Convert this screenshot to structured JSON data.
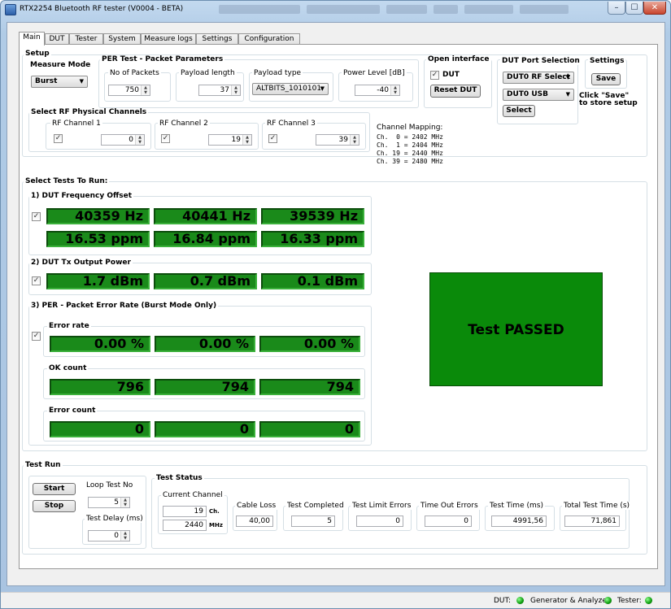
{
  "window": {
    "title": "RTX2254 Bluetooth RF tester (V0004 - BETA)",
    "minimize": "–",
    "maximize": "☐",
    "close": "✕"
  },
  "tabs": [
    "Main",
    "DUT",
    "Tester",
    "System",
    "Measure logs",
    "Settings",
    "Configuration"
  ],
  "setup": {
    "label": "Setup",
    "measure_mode": {
      "label": "Measure Mode",
      "value": "Burst"
    },
    "per": {
      "label": "PER Test - Packet Parameters",
      "no_packets": {
        "label": "No of Packets",
        "value": "750"
      },
      "payload_length": {
        "label": "Payload length",
        "value": "37"
      },
      "payload_type": {
        "label": "Payload type",
        "value": "ALTBITS_1010101"
      },
      "power_level": {
        "label": "Power Level [dB]",
        "value": "-40"
      }
    },
    "open_interface": {
      "label": "Open interface",
      "dut_label": "DUT",
      "reset_label": "Reset DUT"
    },
    "dut_port": {
      "label": "DUT Port Selection",
      "rf_select": "DUT0 RF Select",
      "usb": "DUT0 USB",
      "select_label": "Select"
    },
    "settings": {
      "label": "Settings",
      "save_label": "Save",
      "hint": "Click \"Save\"\nto store setup"
    },
    "rf_channels": {
      "label": "Select RF Physical Channels",
      "items": [
        {
          "label": "RF Channel 1",
          "value": "0"
        },
        {
          "label": "RF Channel 2",
          "value": "19"
        },
        {
          "label": "RF Channel 3",
          "value": "39"
        }
      ]
    },
    "channel_mapping": {
      "label": "Channel Mapping:",
      "lines": [
        "Ch.  0 = 2402 MHz",
        "Ch.  1 = 2404 MHz",
        "Ch. 19 = 2440 MHz",
        "Ch. 39 = 2480 MHz"
      ]
    }
  },
  "tests": {
    "label": "Select Tests To Run:",
    "freq_offset": {
      "label": "1) DUT Frequency Offset",
      "hz": [
        "40359 Hz",
        "40441 Hz",
        "39539 Hz"
      ],
      "ppm": [
        "16.53 ppm",
        "16.84 ppm",
        "16.33 ppm"
      ]
    },
    "tx_power": {
      "label": "2) DUT Tx Output Power",
      "values": [
        "1.7 dBm",
        "0.7 dBm",
        "0.1 dBm"
      ]
    },
    "per": {
      "label": "3) PER - Packet Error Rate (Burst Mode Only)",
      "error_rate": {
        "label": "Error rate",
        "values": [
          "0.00 %",
          "0.00 %",
          "0.00 %"
        ]
      },
      "ok_count": {
        "label": "OK count",
        "values": [
          "796",
          "794",
          "794"
        ]
      },
      "error_count": {
        "label": "Error count",
        "values": [
          "0",
          "0",
          "0"
        ]
      }
    },
    "result": "Test PASSED"
  },
  "test_run": {
    "label": "Test Run",
    "start_label": "Start",
    "stop_label": "Stop",
    "loop": {
      "label": "Loop Test No",
      "value": "5"
    },
    "delay": {
      "label": "Test Delay (ms)",
      "value": "0"
    }
  },
  "test_status": {
    "label": "Test Status",
    "current_channel": {
      "label": "Current Channel",
      "ch": "19",
      "ch_unit": "Ch.",
      "mhz": "2440",
      "mhz_unit": "MHz"
    },
    "cable_loss": {
      "label": "Cable Loss",
      "value": "40,00"
    },
    "test_completed": {
      "label": "Test Completed",
      "value": "5"
    },
    "limit_errors": {
      "label": "Test Limit Errors",
      "value": "0"
    },
    "timeout_errors": {
      "label": "Time Out Errors",
      "value": "0"
    },
    "test_time": {
      "label": "Test Time (ms)",
      "value": "4991,56"
    },
    "total_time": {
      "label": "Total Test Time (s)",
      "value": "71,861"
    }
  },
  "statusbar": {
    "dut": "DUT:",
    "gen": "Generator & Analyzer:",
    "tester": "Tester:"
  },
  "colors": {
    "meter_green": "#1a8a1a",
    "pass_green": "#0a8a0a",
    "led_green": "#0c9a0c"
  }
}
